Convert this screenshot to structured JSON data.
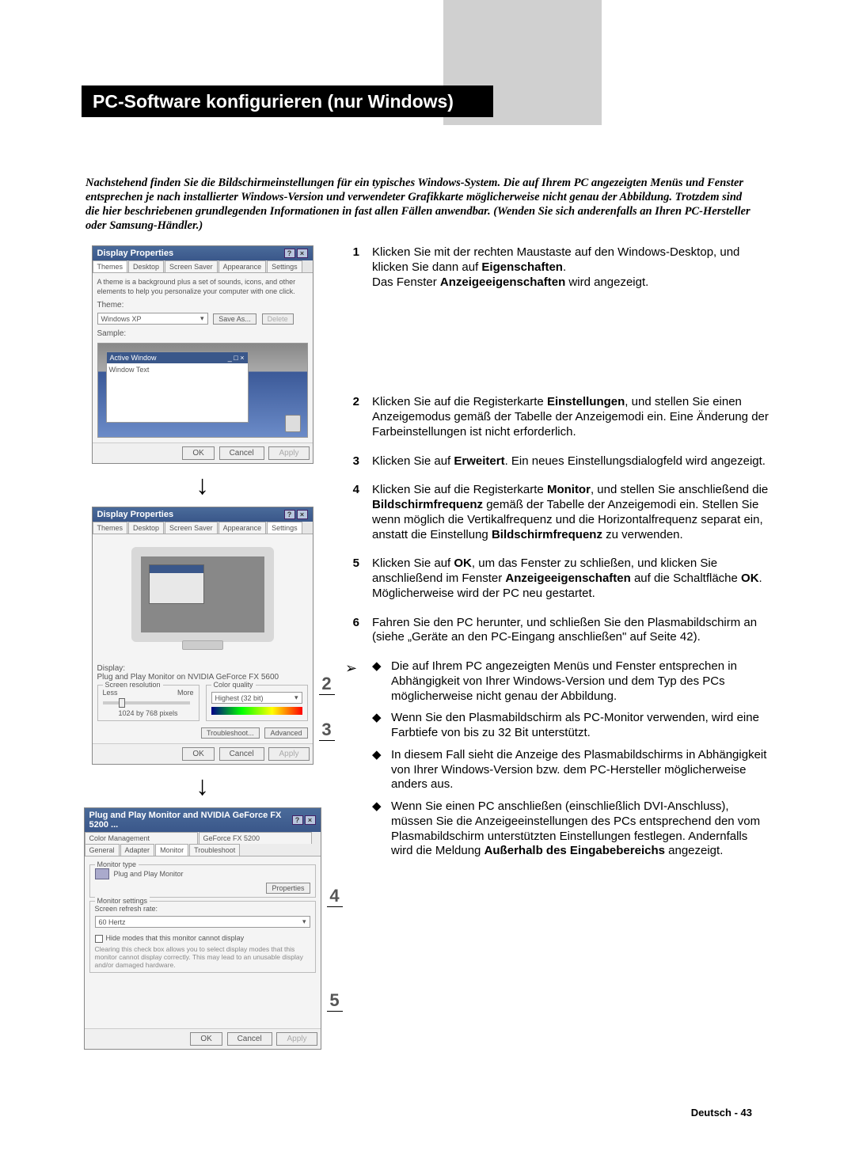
{
  "title": "PC-Software konfigurieren (nur Windows)",
  "intro": "Nachstehend finden Sie die Bildschirmeinstellungen für ein typisches Windows-System. Die auf Ihrem PC  angezeigten Menüs und Fenster entsprechen je nach installierter Windows-Version und verwendeter Grafikkarte möglicherweise nicht genau der Abbildung. Trotzdem sind die hier beschriebenen grundlegenden Informationen in fast allen Fällen anwendbar. (Wenden Sie sich anderenfalls an Ihren PC-Hersteller oder Samsung-Händler.)",
  "steps": [
    {
      "num": "1",
      "text_a": "Klicken Sie mit der rechten Maustaste auf den Windows-Desktop, und klicken Sie dann auf ",
      "bold_a": "Eigenschaften",
      "text_b": ".",
      "text_c": "Das Fenster ",
      "bold_c": "Anzeigeeigenschaften",
      "text_d": " wird angezeigt."
    },
    {
      "num": "2",
      "text_a": "Klicken Sie auf die Registerkarte ",
      "bold_a": "Einstellungen",
      "text_b": ", und stellen Sie einen Anzeigemodus gemäß der Tabelle der Anzeigemodi ein. Eine Änderung der Farbeinstellungen ist nicht erforderlich."
    },
    {
      "num": "3",
      "text_a": "Klicken Sie auf ",
      "bold_a": "Erweitert",
      "text_b": ". Ein neues Einstellungsdialogfeld wird angezeigt."
    },
    {
      "num": "4",
      "text_a": "Klicken Sie auf die Registerkarte ",
      "bold_a": "Monitor",
      "text_b": ", und stellen Sie anschließend die ",
      "bold_b": "Bildschirmfrequenz",
      "text_c": " gemäß der Tabelle der Anzeigemodi ein. Stellen Sie wenn möglich die Vertikalfrequenz und die Horizontalfrequenz separat ein, anstatt die Einstellung ",
      "bold_c": "Bildschirmfrequenz",
      "text_d": " zu verwenden."
    },
    {
      "num": "5",
      "text_a": "Klicken Sie auf ",
      "bold_a": "OK",
      "text_b": ", um das Fenster zu schließen, und klicken Sie anschließend im Fenster ",
      "bold_b": "Anzeigeeigenschaften",
      "text_c": " auf die Schaltfläche ",
      "bold_c": "OK",
      "text_d": ". Möglicherweise wird der PC neu gestartet."
    },
    {
      "num": "6",
      "text_a": "Fahren Sie den PC herunter, und schließen Sie den Plasmabildschirm an (siehe „Geräte an den PC-Eingang anschließen\" auf Seite 42)."
    }
  ],
  "notes": [
    "Die auf Ihrem PC angezeigten Menüs und Fenster entsprechen in Abhängigkeit von Ihrer Windows-Version und dem Typ des PCs möglicherweise nicht genau der Abbildung.",
    "Wenn Sie den Plasmabildschirm als PC-Monitor verwenden, wird eine Farbtiefe von bis zu 32 Bit unterstützt.",
    "In diesem Fall sieht die Anzeige des Plasmabildschirms in Abhängigkeit von Ihrer Windows-Version bzw. dem PC-Hersteller möglicherweise anders aus."
  ],
  "note4_a": "Wenn Sie einen PC anschließen (einschließlich DVI-Anschluss), müssen Sie die Anzeigeeinstellungen des PCs entsprechend den vom Plasmabildschirm unterstützten Einstellungen festlegen. Andernfalls wird die Meldung ",
  "note4_bold": "Außerhalb des Eingabebereichs",
  "note4_b": " angezeigt.",
  "footer": "Deutsch - 43",
  "win1": {
    "title": "Display Properties",
    "tabs": [
      "Themes",
      "Desktop",
      "Screen Saver",
      "Appearance",
      "Settings"
    ],
    "desc": "A theme is a background plus a set of sounds, icons, and other elements to help you personalize your computer with one click.",
    "theme_label": "Theme:",
    "theme_val": "Windows XP",
    "save_as": "Save As...",
    "delete": "Delete",
    "sample": "Sample:",
    "active_window": "Active Window",
    "window_text": "Window Text",
    "ok": "OK",
    "cancel": "Cancel",
    "apply": "Apply"
  },
  "win2": {
    "title": "Display Properties",
    "tabs": [
      "Themes",
      "Desktop",
      "Screen Saver",
      "Appearance",
      "Settings"
    ],
    "display_label": "Display:",
    "display_val": "Plug and Play Monitor on NVIDIA GeForce FX 5600",
    "res_legend": "Screen resolution",
    "less": "Less",
    "more": "More",
    "res_val": "1024 by 768 pixels",
    "color_legend": "Color quality",
    "color_val": "Highest (32 bit)",
    "troubleshoot": "Troubleshoot...",
    "advanced": "Advanced",
    "ok": "OK",
    "cancel": "Cancel",
    "apply": "Apply"
  },
  "win3": {
    "title": "Plug and Play Monitor and NVIDIA GeForce FX 5200 ...",
    "tabs_row1": [
      "Color Management",
      "GeForce FX 5200"
    ],
    "tabs_row2": [
      "General",
      "Adapter",
      "Monitor",
      "Troubleshoot"
    ],
    "mtype_legend": "Monitor type",
    "mtype_val": "Plug and Play Monitor",
    "properties": "Properties",
    "mset_legend": "Monitor settings",
    "refresh_label": "Screen refresh rate:",
    "refresh_val": "60 Hertz",
    "hide": "Hide modes that this monitor cannot display",
    "hide_desc": "Clearing this check box allows you to select display modes that this monitor cannot display correctly. This may lead to an unusable display and/or damaged hardware.",
    "ok": "OK",
    "cancel": "Cancel",
    "apply": "Apply"
  },
  "side_nums": {
    "two": "2",
    "three": "3",
    "four": "4",
    "five": "5"
  }
}
